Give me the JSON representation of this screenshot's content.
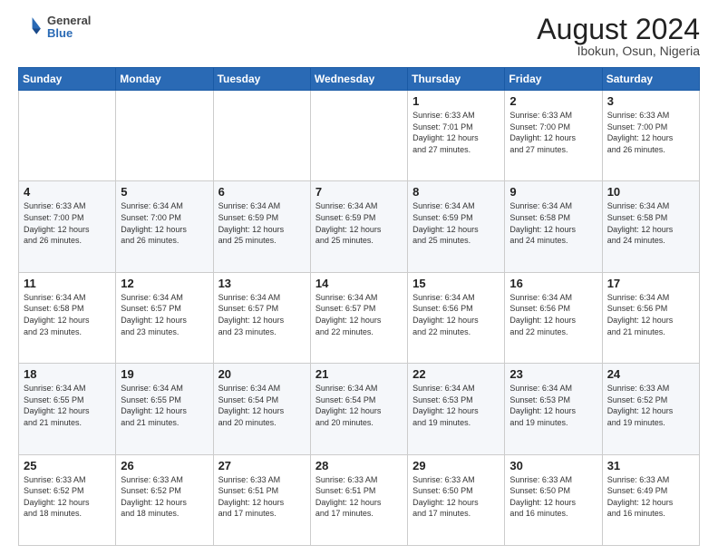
{
  "header": {
    "logo_general": "General",
    "logo_blue": "Blue",
    "month_title": "August 2024",
    "location": "Ibokun, Osun, Nigeria"
  },
  "days_of_week": [
    "Sunday",
    "Monday",
    "Tuesday",
    "Wednesday",
    "Thursday",
    "Friday",
    "Saturday"
  ],
  "weeks": [
    [
      {
        "day": "",
        "info": ""
      },
      {
        "day": "",
        "info": ""
      },
      {
        "day": "",
        "info": ""
      },
      {
        "day": "",
        "info": ""
      },
      {
        "day": "1",
        "info": "Sunrise: 6:33 AM\nSunset: 7:01 PM\nDaylight: 12 hours\nand 27 minutes."
      },
      {
        "day": "2",
        "info": "Sunrise: 6:33 AM\nSunset: 7:00 PM\nDaylight: 12 hours\nand 27 minutes."
      },
      {
        "day": "3",
        "info": "Sunrise: 6:33 AM\nSunset: 7:00 PM\nDaylight: 12 hours\nand 26 minutes."
      }
    ],
    [
      {
        "day": "4",
        "info": "Sunrise: 6:33 AM\nSunset: 7:00 PM\nDaylight: 12 hours\nand 26 minutes."
      },
      {
        "day": "5",
        "info": "Sunrise: 6:34 AM\nSunset: 7:00 PM\nDaylight: 12 hours\nand 26 minutes."
      },
      {
        "day": "6",
        "info": "Sunrise: 6:34 AM\nSunset: 6:59 PM\nDaylight: 12 hours\nand 25 minutes."
      },
      {
        "day": "7",
        "info": "Sunrise: 6:34 AM\nSunset: 6:59 PM\nDaylight: 12 hours\nand 25 minutes."
      },
      {
        "day": "8",
        "info": "Sunrise: 6:34 AM\nSunset: 6:59 PM\nDaylight: 12 hours\nand 25 minutes."
      },
      {
        "day": "9",
        "info": "Sunrise: 6:34 AM\nSunset: 6:58 PM\nDaylight: 12 hours\nand 24 minutes."
      },
      {
        "day": "10",
        "info": "Sunrise: 6:34 AM\nSunset: 6:58 PM\nDaylight: 12 hours\nand 24 minutes."
      }
    ],
    [
      {
        "day": "11",
        "info": "Sunrise: 6:34 AM\nSunset: 6:58 PM\nDaylight: 12 hours\nand 23 minutes."
      },
      {
        "day": "12",
        "info": "Sunrise: 6:34 AM\nSunset: 6:57 PM\nDaylight: 12 hours\nand 23 minutes."
      },
      {
        "day": "13",
        "info": "Sunrise: 6:34 AM\nSunset: 6:57 PM\nDaylight: 12 hours\nand 23 minutes."
      },
      {
        "day": "14",
        "info": "Sunrise: 6:34 AM\nSunset: 6:57 PM\nDaylight: 12 hours\nand 22 minutes."
      },
      {
        "day": "15",
        "info": "Sunrise: 6:34 AM\nSunset: 6:56 PM\nDaylight: 12 hours\nand 22 minutes."
      },
      {
        "day": "16",
        "info": "Sunrise: 6:34 AM\nSunset: 6:56 PM\nDaylight: 12 hours\nand 22 minutes."
      },
      {
        "day": "17",
        "info": "Sunrise: 6:34 AM\nSunset: 6:56 PM\nDaylight: 12 hours\nand 21 minutes."
      }
    ],
    [
      {
        "day": "18",
        "info": "Sunrise: 6:34 AM\nSunset: 6:55 PM\nDaylight: 12 hours\nand 21 minutes."
      },
      {
        "day": "19",
        "info": "Sunrise: 6:34 AM\nSunset: 6:55 PM\nDaylight: 12 hours\nand 21 minutes."
      },
      {
        "day": "20",
        "info": "Sunrise: 6:34 AM\nSunset: 6:54 PM\nDaylight: 12 hours\nand 20 minutes."
      },
      {
        "day": "21",
        "info": "Sunrise: 6:34 AM\nSunset: 6:54 PM\nDaylight: 12 hours\nand 20 minutes."
      },
      {
        "day": "22",
        "info": "Sunrise: 6:34 AM\nSunset: 6:53 PM\nDaylight: 12 hours\nand 19 minutes."
      },
      {
        "day": "23",
        "info": "Sunrise: 6:34 AM\nSunset: 6:53 PM\nDaylight: 12 hours\nand 19 minutes."
      },
      {
        "day": "24",
        "info": "Sunrise: 6:33 AM\nSunset: 6:52 PM\nDaylight: 12 hours\nand 19 minutes."
      }
    ],
    [
      {
        "day": "25",
        "info": "Sunrise: 6:33 AM\nSunset: 6:52 PM\nDaylight: 12 hours\nand 18 minutes."
      },
      {
        "day": "26",
        "info": "Sunrise: 6:33 AM\nSunset: 6:52 PM\nDaylight: 12 hours\nand 18 minutes."
      },
      {
        "day": "27",
        "info": "Sunrise: 6:33 AM\nSunset: 6:51 PM\nDaylight: 12 hours\nand 17 minutes."
      },
      {
        "day": "28",
        "info": "Sunrise: 6:33 AM\nSunset: 6:51 PM\nDaylight: 12 hours\nand 17 minutes."
      },
      {
        "day": "29",
        "info": "Sunrise: 6:33 AM\nSunset: 6:50 PM\nDaylight: 12 hours\nand 17 minutes."
      },
      {
        "day": "30",
        "info": "Sunrise: 6:33 AM\nSunset: 6:50 PM\nDaylight: 12 hours\nand 16 minutes."
      },
      {
        "day": "31",
        "info": "Sunrise: 6:33 AM\nSunset: 6:49 PM\nDaylight: 12 hours\nand 16 minutes."
      }
    ]
  ]
}
